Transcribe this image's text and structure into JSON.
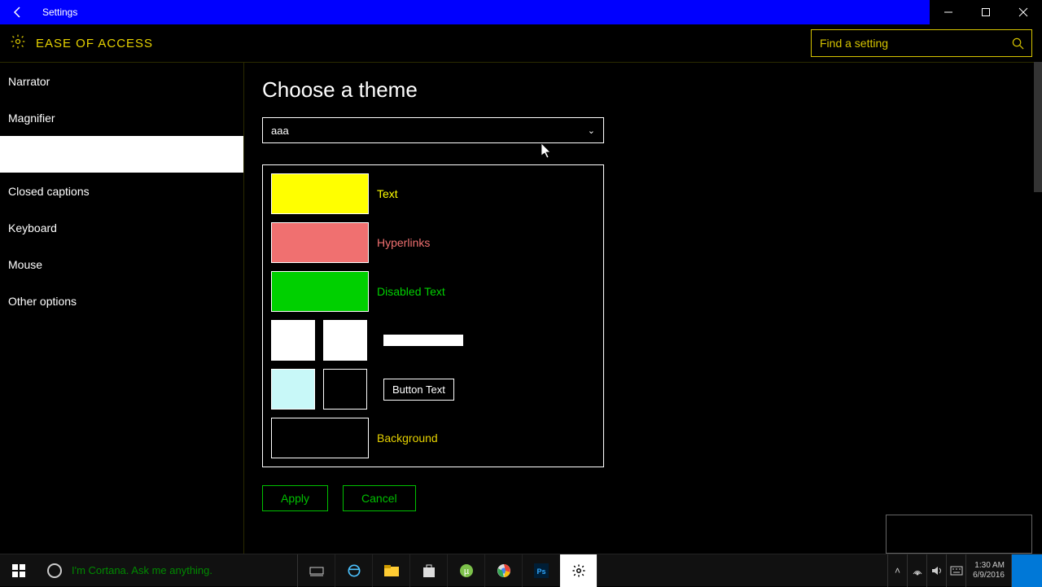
{
  "titlebar": {
    "title": "Settings"
  },
  "header": {
    "category": "EASE OF ACCESS",
    "search_placeholder": "Find a setting"
  },
  "sidebar": {
    "items": [
      {
        "label": "Narrator"
      },
      {
        "label": "Magnifier"
      },
      {
        "label": ""
      },
      {
        "label": "Closed captions"
      },
      {
        "label": "Keyboard"
      },
      {
        "label": "Mouse"
      },
      {
        "label": "Other options"
      }
    ]
  },
  "content": {
    "heading": "Choose a theme",
    "dropdown_value": "aaa",
    "rows": {
      "text": {
        "label": "Text",
        "color": "#ffff00",
        "label_color": "#ffff00"
      },
      "hyperlinks": {
        "label": "Hyperlinks",
        "color": "#f07070",
        "label_color": "#f07070"
      },
      "disabled": {
        "label": "Disabled Text",
        "color": "#00d000",
        "label_color": "#00d000"
      },
      "selected": {
        "color1": "#ffffff",
        "color2": "#ffffff"
      },
      "button": {
        "label": "Button Text",
        "color1": "#c8f8f8",
        "color2": "#000000"
      },
      "background": {
        "label": "Background",
        "color": "#000000",
        "label_color": "#e6d200"
      }
    },
    "apply": "Apply",
    "cancel": "Cancel"
  },
  "taskbar": {
    "cortana": "I'm Cortana. Ask me anything.",
    "time": "1:30 AM",
    "date": "6/9/2016"
  }
}
